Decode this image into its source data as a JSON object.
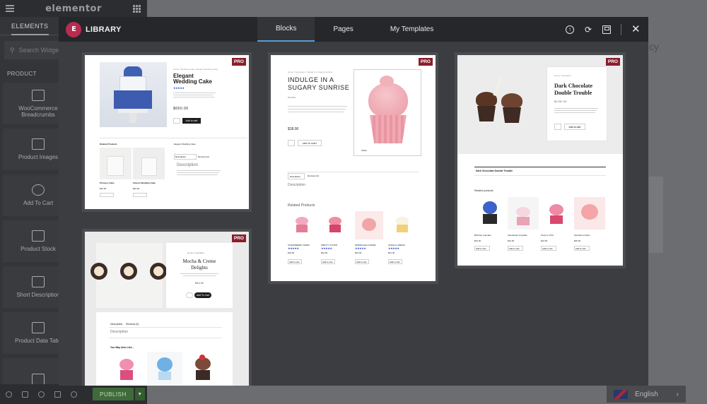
{
  "editor": {
    "logo": "elementor",
    "tab_elements": "ELEMENTS",
    "search_placeholder": "Search Widget",
    "section": "PRODUCT",
    "widgets": [
      {
        "label": "WooCommerce Breadcrumbs"
      },
      {
        "label": "Product Images"
      },
      {
        "label": "Add To Cart"
      },
      {
        "label": "Product Stock"
      },
      {
        "label": "Short Description"
      },
      {
        "label": "Product Data Tabs"
      }
    ],
    "publish": "PUBLISH",
    "language": "English",
    "bg_text": "cy"
  },
  "library": {
    "title": "LIBRARY",
    "tabs": [
      {
        "label": "Blocks",
        "active": true
      },
      {
        "label": "Pages",
        "active": false
      },
      {
        "label": "My Templates",
        "active": false
      }
    ],
    "pro_badge": "PRO",
    "colors": {
      "accent_tab": "#5a9bd5",
      "pro_badge": "#8a1e2d",
      "logo": "#b72c4f"
    },
    "templates": [
      {
        "id": "wedding",
        "title": "Elegant Wedding Cake",
        "price": "$650.00",
        "add_to_cart": "Add to cart",
        "related_heading": "Related Products",
        "related": [
          {
            "name": "Princess Cake",
            "price": "$34.00"
          },
          {
            "name": "Classic Wedding Cake",
            "price": "$40.00"
          }
        ],
        "tabs": [
          "Description",
          "Reviews (0)"
        ],
        "desc_heading": "Description",
        "sub_title": "Elegant Wedding Cake"
      },
      {
        "id": "cupcake",
        "title_line1": "INDULGE IN A",
        "title_line2": "SUGARY SUNRISE",
        "price": "$18.00",
        "add_to_cart": "ADD TO CART",
        "tabs": [
          "Description",
          "Reviews (0)"
        ],
        "desc_heading": "Description",
        "related_heading": "Related Products",
        "related": [
          {
            "name": "STRAWBERRY SWIRL",
            "price": "$18.00"
          },
          {
            "name": "PRETTY IN PINK",
            "price": "$24.00"
          },
          {
            "name": "SPRINKLES & MORE",
            "price": "$23.00"
          },
          {
            "name": "VANILLA CREAM",
            "price": "$21.00"
          }
        ],
        "add_label": "Add to cart"
      },
      {
        "id": "chocolate",
        "title_line1": "Dark Chocolate",
        "title_line2": "Double Trouble",
        "price": "$135.00",
        "add_to_cart": "Add to cart",
        "bar_title": "Dark Chocolate Double Trouble",
        "related_heading": "Related products",
        "related": [
          {
            "name": "Birthday Cupcake",
            "price": "$24.00"
          },
          {
            "name": "Sweetheart Cupcake",
            "price": "$22.00"
          },
          {
            "name": "Pretty In Pink",
            "price": "$24.00"
          },
          {
            "name": "Sprinkles & More",
            "price": "$25.00"
          }
        ],
        "add_label": "Add to cart"
      },
      {
        "id": "mocha",
        "title_line1": "Mocha & Creme",
        "title_line2": "Delights",
        "price": "$34.00",
        "add_to_cart": "Add To Cart",
        "tabs": [
          "Description",
          "Reviews (0)"
        ],
        "desc_heading": "Description",
        "related_heading": "You May Also Like..."
      }
    ]
  }
}
